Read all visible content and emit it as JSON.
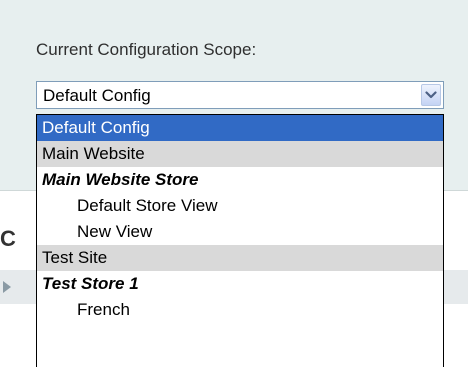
{
  "scope": {
    "label": "Current Configuration Scope:",
    "selected_value": "Default Config",
    "options": [
      {
        "label": "Default Config",
        "level": "default",
        "selected": true
      },
      {
        "label": "Main Website",
        "level": "website"
      },
      {
        "label": "Main Website Store",
        "level": "store"
      },
      {
        "label": "Default Store View",
        "level": "view"
      },
      {
        "label": "New View",
        "level": "view"
      },
      {
        "label": "Test Site",
        "level": "website"
      },
      {
        "label": "Test Store 1",
        "level": "store"
      },
      {
        "label": "French",
        "level": "view"
      }
    ]
  },
  "page": {
    "heading_fragment": "C"
  },
  "colors": {
    "selected_bg": "#316ac5",
    "website_bg": "#d9d9d9",
    "panel_bg": "#e7efef"
  },
  "icons": {
    "dropdown_arrow": "chevron-down-icon",
    "row_expand": "triangle-right-icon"
  }
}
